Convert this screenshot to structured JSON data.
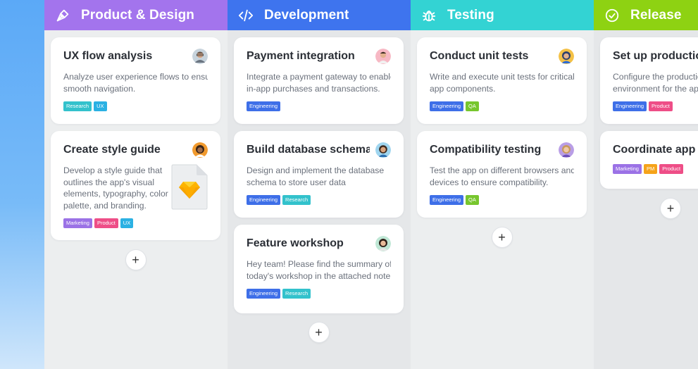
{
  "columns": [
    {
      "title": "Product & Design",
      "icon": "pen-nib-icon",
      "color": "#a374ed",
      "cards": [
        {
          "title": "UX flow analysis",
          "desc": [
            "Analyze user experience flows to ensure",
            "smooth navigation."
          ],
          "tags": [
            {
              "label": "Research",
              "color": "#33c2cc"
            },
            {
              "label": "UX",
              "color": "#2bb1e3"
            }
          ],
          "avatar": "avatar-man-glasses"
        },
        {
          "title": "Create style guide",
          "desc": [
            "Develop a style guide that",
            "outlines the app's visual",
            "elements, typography, color",
            "palette, and branding."
          ],
          "tags": [
            {
              "label": "Marketing",
              "color": "#9b72e6"
            },
            {
              "label": "Product",
              "color": "#ee4e87"
            },
            {
              "label": "UX",
              "color": "#2bb1e3"
            }
          ],
          "avatar": "avatar-woman-curly",
          "attachment": "sketch-file-icon"
        }
      ]
    },
    {
      "title": "Development",
      "icon": "code-icon",
      "color": "#3e74ee",
      "cards": [
        {
          "title": "Payment integration",
          "desc": [
            "Integrate a payment gateway to enable",
            "in-app purchases and transactions."
          ],
          "tags": [
            {
              "label": "Engineering",
              "color": "#3e6fe8"
            }
          ],
          "avatar": "avatar-man-pink"
        },
        {
          "title": "Build database schema",
          "desc": [
            "Design and implement the database",
            "schema to store user data"
          ],
          "tags": [
            {
              "label": "Engineering",
              "color": "#3e6fe8"
            },
            {
              "label": "Research",
              "color": "#33c2cc"
            }
          ],
          "avatar": "avatar-woman-blue"
        },
        {
          "title": "Feature workshop",
          "desc": [
            "Hey team! Please find the summary of",
            "today's workshop in the attached note."
          ],
          "tags": [
            {
              "label": "Engineering",
              "color": "#3e6fe8"
            },
            {
              "label": "Research",
              "color": "#33c2cc"
            }
          ],
          "avatar": "avatar-woman-green"
        }
      ]
    },
    {
      "title": "Testing",
      "icon": "bug-icon",
      "color": "#33d3d3",
      "cards": [
        {
          "title": "Conduct unit tests",
          "desc": [
            "Write and execute unit tests for critical",
            "app components."
          ],
          "tags": [
            {
              "label": "Engineering",
              "color": "#3e6fe8"
            },
            {
              "label": "QA",
              "color": "#77c62e"
            }
          ],
          "avatar": "avatar-woman-glasses"
        },
        {
          "title": "Compatibility testing",
          "desc": [
            "Test the app on different browsers and",
            "devices to ensure compatibility."
          ],
          "tags": [
            {
              "label": "Engineering",
              "color": "#3e6fe8"
            },
            {
              "label": "QA",
              "color": "#77c62e"
            }
          ],
          "avatar": "avatar-woman-purple"
        }
      ]
    },
    {
      "title": "Release",
      "icon": "check-circle-icon",
      "color": "#8ed212",
      "cards": [
        {
          "title": "Set up productio",
          "desc": [
            "Configure the productio",
            "environment for the app"
          ],
          "tags": [
            {
              "label": "Engineering",
              "color": "#3e6fe8"
            },
            {
              "label": "Product",
              "color": "#ee4e87"
            }
          ],
          "avatar": ""
        },
        {
          "title": "Coordinate app r",
          "desc": [],
          "tags": [
            {
              "label": "Marketing",
              "color": "#9b72e6"
            },
            {
              "label": "PM",
              "color": "#f5a31a"
            },
            {
              "label": "Product",
              "color": "#ee4e87"
            }
          ],
          "avatar": ""
        }
      ]
    }
  ],
  "add_button_label": "+"
}
